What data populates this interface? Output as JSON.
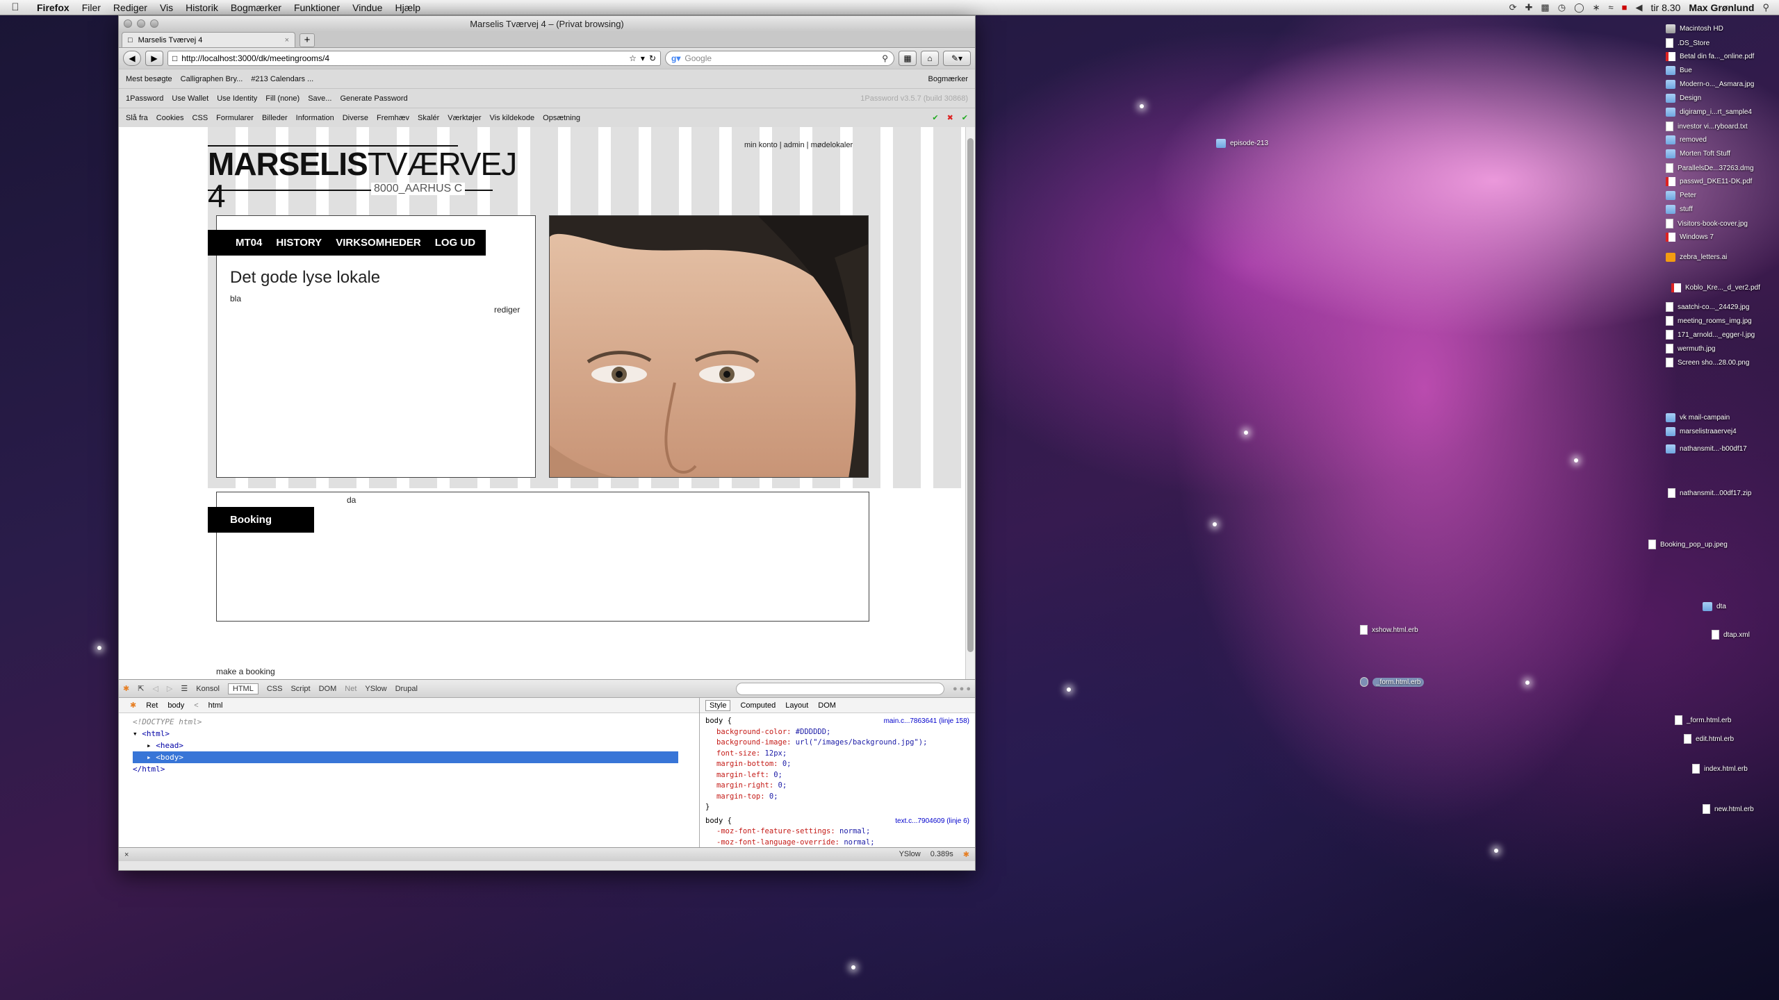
{
  "menubar": {
    "app": "Firefox",
    "items": [
      "Filer",
      "Rediger",
      "Vis",
      "Historik",
      "Bogmærker",
      "Funktioner",
      "Vindue",
      "Hjælp"
    ],
    "clock": "tir 8.30",
    "user": "Max Grønlund"
  },
  "window": {
    "title": "Marselis Tværvej 4 – (Privat browsing)",
    "tab_label": "Marselis Tværvej 4",
    "url": "http://localhost:3000/dk/meetingrooms/4",
    "search_placeholder": "Google"
  },
  "bookmarks": {
    "items": [
      "Mest besøgte",
      "Calligraphen Bry...",
      "#213 Calendars ..."
    ],
    "right": "Bogmærker"
  },
  "onepassword": {
    "items": [
      "1Password",
      "Use Wallet",
      "Use Identity",
      "Fill (none)",
      "Save...",
      "Generate Password"
    ],
    "version": "1Password v3.5.7 (build 30868)"
  },
  "webdev": {
    "items": [
      "Slå fra",
      "Cookies",
      "CSS",
      "Formularer",
      "Billeder",
      "Information",
      "Diverse",
      "Fremhæv",
      "Skalér",
      "Værktøjer",
      "Vis kildekode",
      "Opsætning"
    ]
  },
  "page": {
    "logo_bold": "MARSELIS",
    "logo_light": "TVÆRVEJ 4",
    "logo_sub": "8000_AARHUS C",
    "toplinks": "min konto | admin | mødelokaler",
    "nav": [
      "MT04",
      "HISTORY",
      "VIRKSOMHEDER",
      "LOG UD"
    ],
    "heading": "Det gode lyse lokale",
    "body": "bla",
    "edit": "rediger",
    "da": "da",
    "booking": "Booking",
    "make_booking": "make a booking"
  },
  "firebug": {
    "tabs": [
      "Konsol",
      "HTML",
      "CSS",
      "Script",
      "DOM",
      "Net",
      "YSlow",
      "Drupal"
    ],
    "breadcrumb": [
      "Ret",
      "body",
      "<",
      "html"
    ],
    "tree": [
      "<!DOCTYPE html>",
      "<html>",
      "<head>",
      "<body>",
      "</html>"
    ],
    "side_tabs": [
      "Style",
      "Computed",
      "Layout",
      "DOM"
    ],
    "rules": [
      {
        "selector": "body {",
        "source": "main.c...7863641 (linje 158)",
        "props": [
          [
            "background-color:",
            "#DDDDDD;"
          ],
          [
            "background-image:",
            "url(\"/images/background.jpg\");"
          ],
          [
            "font-size:",
            "12px;"
          ],
          [
            "margin-bottom:",
            "0;"
          ],
          [
            "margin-left:",
            "0;"
          ],
          [
            "margin-right:",
            "0;"
          ],
          [
            "margin-top:",
            "0;"
          ]
        ]
      },
      {
        "selector": "body {",
        "source": "text.c...7904609 (linje 6)",
        "props": [
          [
            "-moz-font-feature-settings:",
            "normal;"
          ],
          [
            "-moz-font-language-override:",
            "normal;"
          ]
        ]
      }
    ]
  },
  "status": {
    "yslow": "YSlow",
    "time": "0.389s"
  },
  "desktop": [
    {
      "label": "Macintosh HD",
      "kind": "disk"
    },
    {
      "label": ".DS_Store",
      "kind": "file"
    },
    {
      "label": "Betal din fa..._online.pdf",
      "kind": "pdf"
    },
    {
      "label": "Bue",
      "kind": "folder"
    },
    {
      "label": "Modern-o..._Asmara.jpg",
      "kind": "folder"
    },
    {
      "label": "Design",
      "kind": "folder"
    },
    {
      "label": "digiramp_i...rt_sample4",
      "kind": "folder"
    },
    {
      "label": "investor vi...ryboard.txt",
      "kind": "file"
    },
    {
      "label": "removed",
      "kind": "folder"
    },
    {
      "label": "Morten Toft Stuff",
      "kind": "folder"
    },
    {
      "label": "ParallelsDe...37263.dmg",
      "kind": "file"
    },
    {
      "label": "passwd_DKE11-DK.pdf",
      "kind": "pdf"
    },
    {
      "label": "Peter",
      "kind": "folder"
    },
    {
      "label": "stuff",
      "kind": "folder"
    },
    {
      "label": "Visitors-book-cover.jpg",
      "kind": "file"
    },
    {
      "label": "Windows 7",
      "kind": "pdf"
    },
    {
      "label": "zebra_letters.ai",
      "kind": "ai"
    },
    {
      "label": "Koblo_Kre..._d_ver2.pdf",
      "kind": "pdf"
    },
    {
      "label": "saatchi-co..._24429.jpg",
      "kind": "file"
    },
    {
      "label": "meeting_rooms_img.jpg",
      "kind": "file"
    },
    {
      "label": "171_arnold..._egger-l.jpg",
      "kind": "file"
    },
    {
      "label": "wermuth.jpg",
      "kind": "file"
    },
    {
      "label": "Screen sho...28.00.png",
      "kind": "file"
    },
    {
      "label": "vk mail-campain",
      "kind": "folder"
    },
    {
      "label": "marselistraaervej4",
      "kind": "folder"
    },
    {
      "label": "nathansmit...-b00df17",
      "kind": "folder"
    },
    {
      "label": "nathansmit...00df17.zip",
      "kind": "file"
    },
    {
      "label": "Booking_pop_up.jpeg",
      "kind": "file"
    },
    {
      "label": "episode-213",
      "kind": "folder"
    },
    {
      "label": "dta",
      "kind": "folder"
    },
    {
      "label": "dtap.xml",
      "kind": "file"
    },
    {
      "label": "xshow.html.erb",
      "kind": "file"
    },
    {
      "label": "_form.html.erb",
      "kind": "file"
    },
    {
      "label": "_form.html.erb",
      "kind": "file"
    },
    {
      "label": "edit.html.erb",
      "kind": "file"
    },
    {
      "label": "index.html.erb",
      "kind": "file"
    },
    {
      "label": "new.html.erb",
      "kind": "file"
    }
  ]
}
